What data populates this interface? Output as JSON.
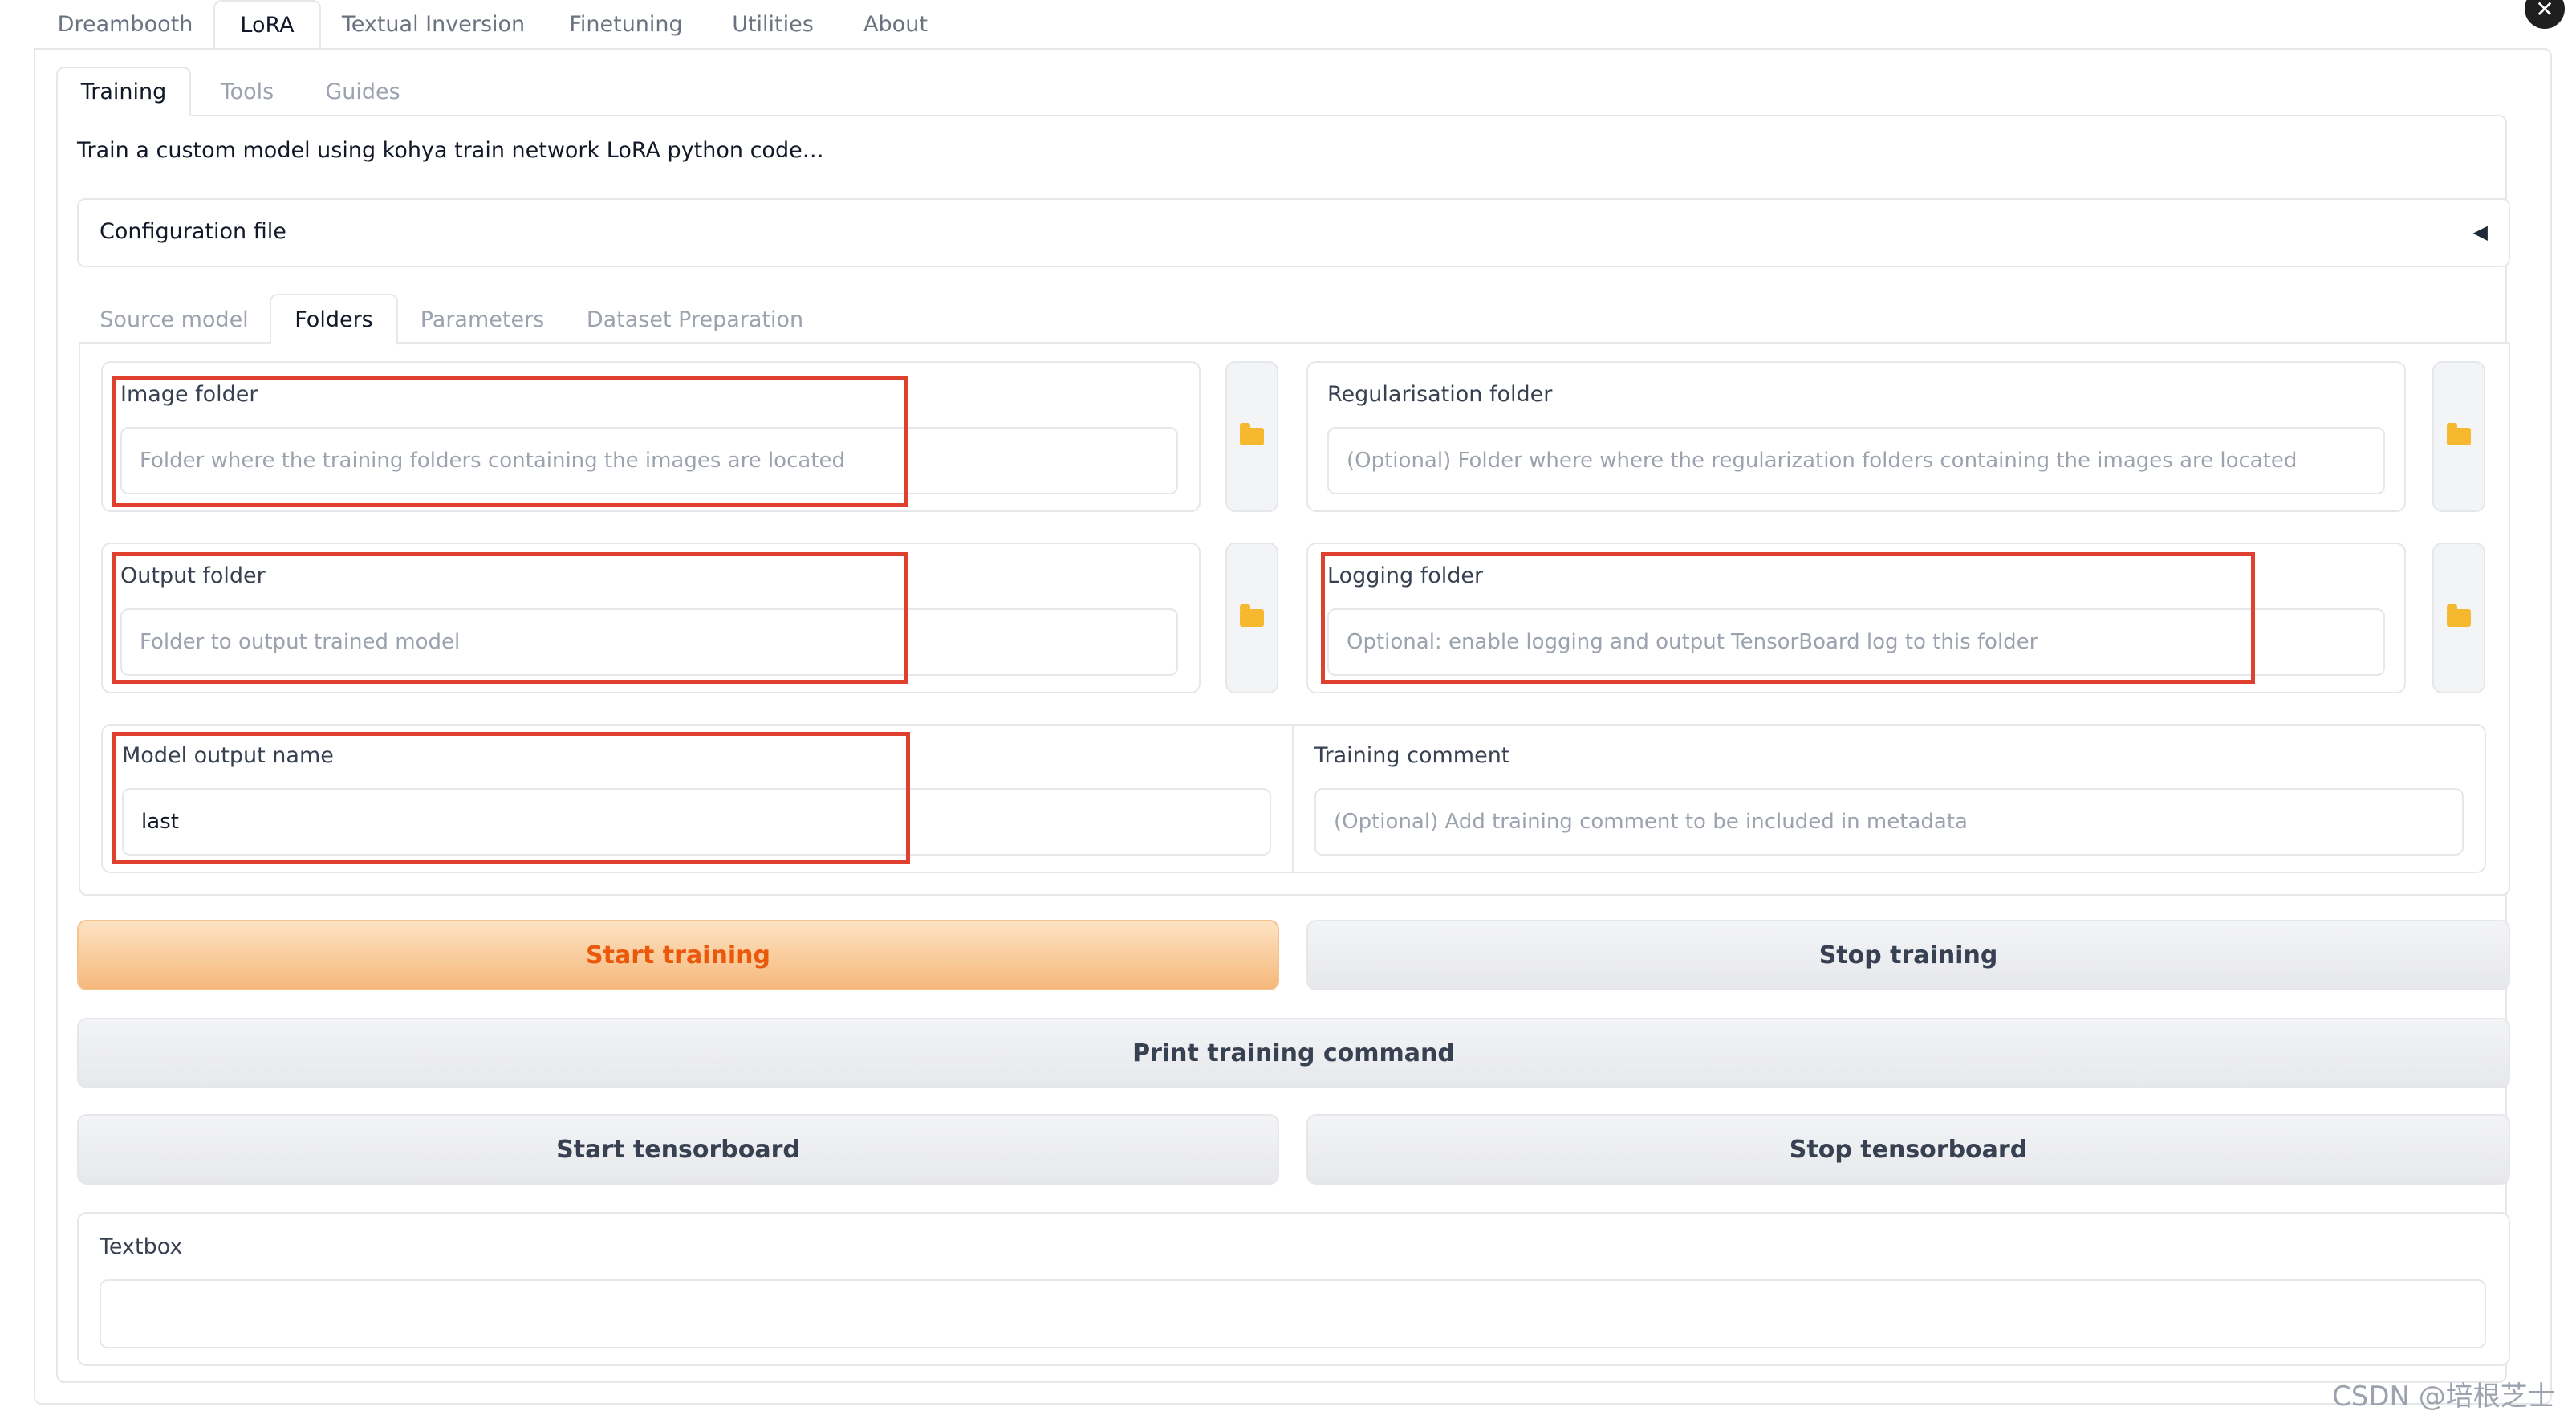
{
  "top_tabs": [
    "Dreambooth",
    "LoRA",
    "Textual Inversion",
    "Finetuning",
    "Utilities",
    "About"
  ],
  "sub_tabs": [
    "Training",
    "Tools",
    "Guides"
  ],
  "description": "Train a custom model using kohya train network LoRA python code…",
  "config": {
    "label": "Configuration file",
    "toggle_glyph": "◀"
  },
  "inner_tabs": [
    "Source model",
    "Folders",
    "Parameters",
    "Dataset Preparation"
  ],
  "fields": {
    "image_folder": {
      "label": "Image folder",
      "placeholder": "Folder where the training folders containing the images are located",
      "value": ""
    },
    "reg_folder": {
      "label": "Regularisation folder",
      "placeholder": "(Optional) Folder where where the regularization folders containing the images are located",
      "value": ""
    },
    "output_folder": {
      "label": "Output folder",
      "placeholder": "Folder to output trained model",
      "value": ""
    },
    "logging_folder": {
      "label": "Logging folder",
      "placeholder": "Optional: enable logging and output TensorBoard log to this folder",
      "value": ""
    },
    "model_output_name": {
      "label": "Model output name",
      "placeholder": "",
      "value": "last"
    },
    "training_comment": {
      "label": "Training comment",
      "placeholder": "(Optional) Add training comment to be included in metadata",
      "value": ""
    },
    "textbox": {
      "label": "Textbox",
      "placeholder": "",
      "value": ""
    }
  },
  "buttons": {
    "start_training": "Start training",
    "stop_training": "Stop training",
    "print_command": "Print training command",
    "start_tensorboard": "Start tensorboard",
    "stop_tensorboard": "Stop tensorboard"
  },
  "icons": {
    "folder": "folder-icon",
    "close": "close-icon"
  },
  "colors": {
    "highlight": "#e0412f",
    "primary_text": "#ea580c",
    "folder": "#f5b82e"
  },
  "watermark": "CSDN @培根芝士"
}
